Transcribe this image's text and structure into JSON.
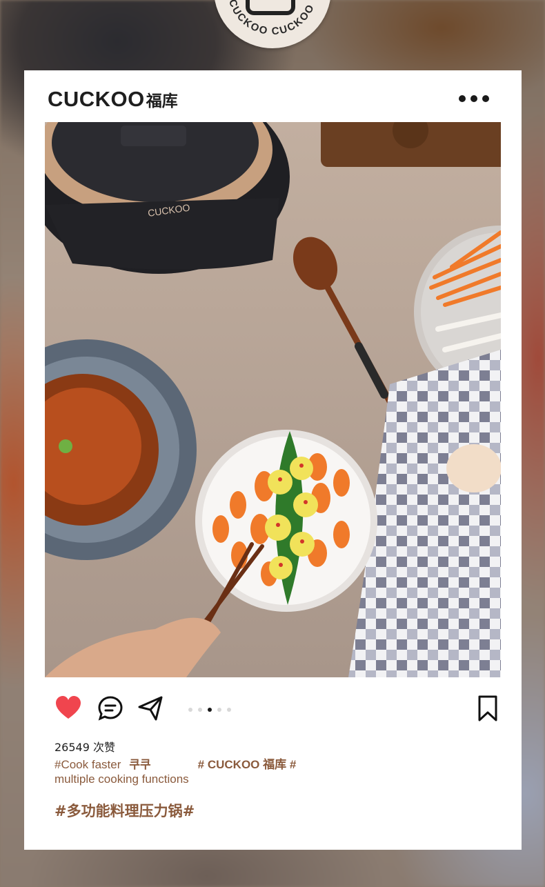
{
  "brand": {
    "logo_latin": "CUCKOO",
    "logo_cn": "福库",
    "badge_text": "CUCKOO CUCKOO"
  },
  "post": {
    "likes_count": "26549",
    "likes_suffix": "次赞",
    "caption": {
      "line1_part1": "#Cook  faster",
      "line1_kr": "쿠쿠",
      "line1_brand": "# CUCKOO 福库 #",
      "line2": "multiple  cooking  functions"
    },
    "hashtag": "#多功能料理压力锅#",
    "carousel": {
      "count": 5,
      "active_index": 2
    }
  },
  "colors": {
    "accent_brown": "#8a5a3c",
    "heart_red": "#f0454e",
    "text_dark": "#1d1d1d"
  },
  "icons": [
    "heart-icon",
    "comment-icon",
    "send-icon",
    "bookmark-icon",
    "more-icon"
  ]
}
